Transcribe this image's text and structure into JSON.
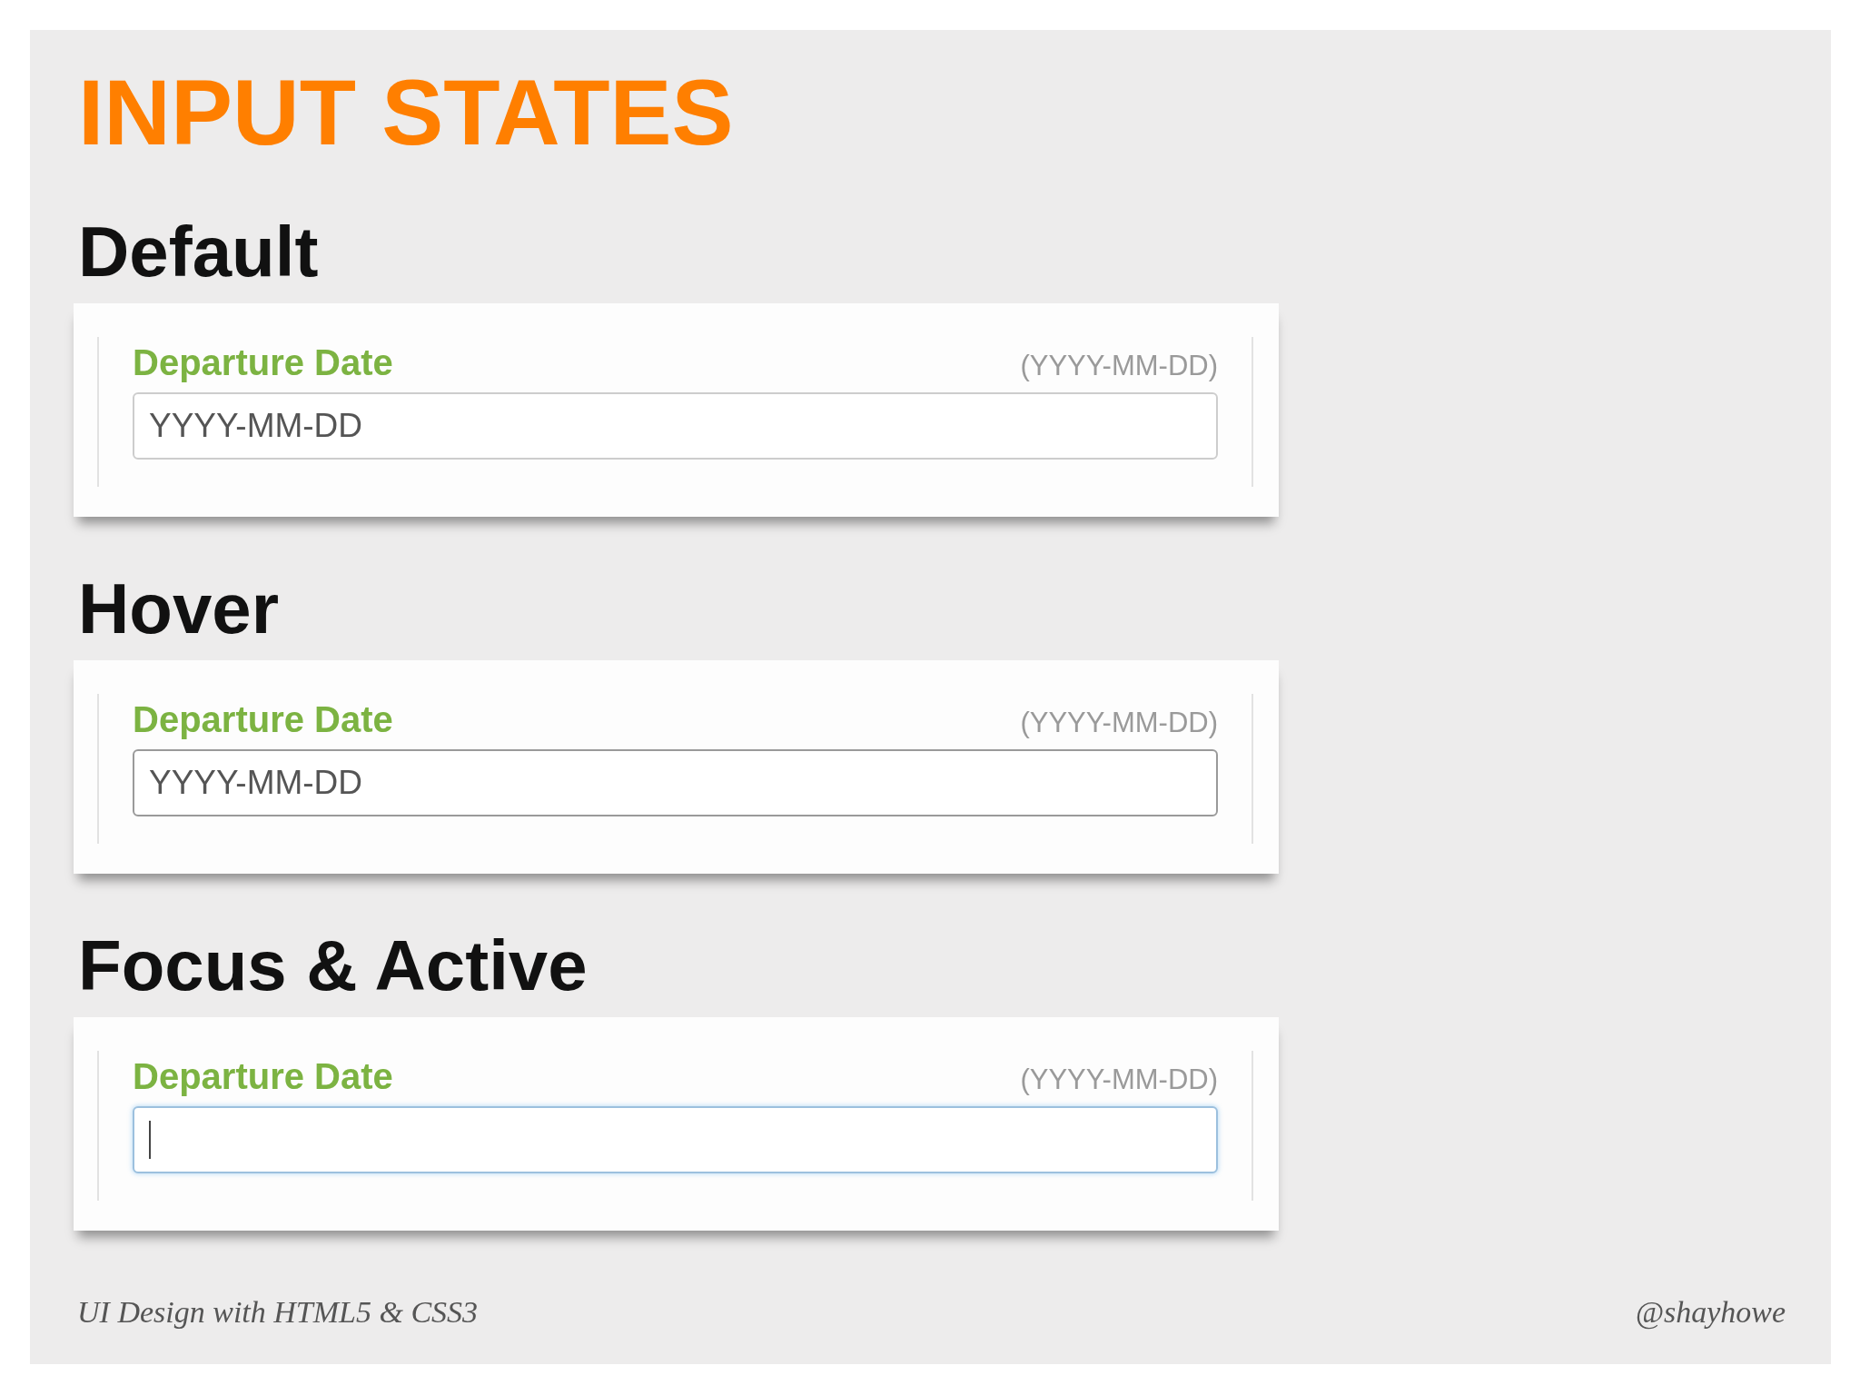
{
  "title": "INPUT STATES",
  "sections": [
    {
      "heading": "Default",
      "hovered": false,
      "focused": false,
      "label": "Departure Date",
      "hint": "(YYYY-MM-DD)",
      "placeholder": "YYYY-MM-DD"
    },
    {
      "heading": "Hover",
      "hovered": true,
      "focused": false,
      "label": "Departure Date",
      "hint": "(YYYY-MM-DD)",
      "placeholder": "YYYY-MM-DD"
    },
    {
      "heading": "Focus & Active",
      "hovered": false,
      "focused": true,
      "label": "Departure Date",
      "hint": "(YYYY-MM-DD)"
    }
  ],
  "footer": {
    "left": "UI Design with HTML5 & CSS3",
    "right": "@shayhowe"
  }
}
